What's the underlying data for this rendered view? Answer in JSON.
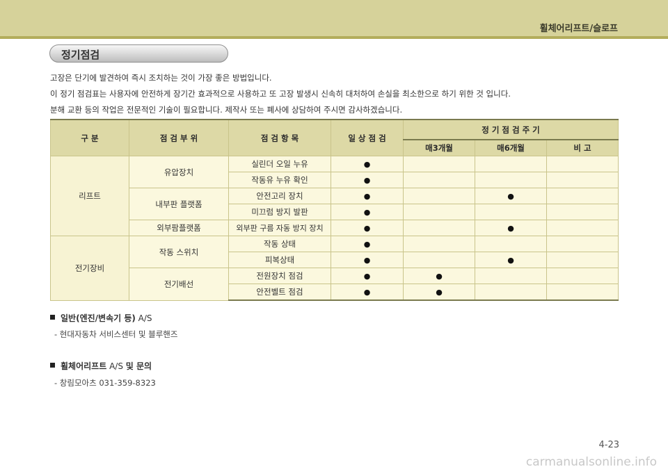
{
  "header": {
    "title": "휠체어리프트/슬로프"
  },
  "section": {
    "title": "정기점검"
  },
  "intro": [
    "고장은 단기에 발견하여 즉시 조치하는 것이 가장 좋은 방법입니다.",
    "이 정기 점검표는 사용자에 안전하게 장기간 효과적으로 사용하고 또 고장 발생시 신속히 대처하여 손실을 최소한으로 하기 위한 것 입니다.",
    "분해 교환 등의 작업은 전문적인 기술이 필요합니다. 제작사 또는 폐사에 상담하여 주시면 감사하겠습니다."
  ],
  "table": {
    "headers": {
      "category": "구 분",
      "part": "점 검 부 위",
      "item": "점 검 항 목",
      "daily": "일 상 점 검",
      "cycle": "정 기 점 검 주 기",
      "m3": "매3개월",
      "m6": "매6개월",
      "remark": "비 고"
    },
    "dot": "●",
    "categories": [
      "리프트",
      "전기장비"
    ],
    "parts": [
      "유압장치",
      "내부판 플랫폼",
      "외부팜플랫폼",
      "작동 스위치",
      "전기배선"
    ],
    "items": [
      "실린더 오일 누유",
      "작동유 누유 확인",
      "안전고리 장치",
      "미끄럼 방지 발판",
      "외부판 구름 자동 방지 장치",
      "작동 상태",
      "피복상태",
      "전원장치 점검",
      "안전벨트 점검"
    ],
    "marks": [
      {
        "daily": true,
        "m3": false,
        "m6": false
      },
      {
        "daily": true,
        "m3": false,
        "m6": false
      },
      {
        "daily": true,
        "m3": false,
        "m6": true
      },
      {
        "daily": true,
        "m3": false,
        "m6": false
      },
      {
        "daily": true,
        "m3": false,
        "m6": true
      },
      {
        "daily": true,
        "m3": false,
        "m6": false
      },
      {
        "daily": true,
        "m3": false,
        "m6": true
      },
      {
        "daily": true,
        "m3": true,
        "m6": false
      },
      {
        "daily": true,
        "m3": true,
        "m6": false
      }
    ]
  },
  "notes": [
    {
      "bold": "일반(엔진/변속기 등)",
      "rest": " A/S",
      "sub": "- 현대자동차 서비스센터 및 블루핸즈"
    },
    {
      "bold": "휠체어리프트",
      "rest": " A/S ",
      "bold2": "및 문의",
      "sub": "- 창림모아츠   031-359-8323"
    }
  ],
  "page_number": "4-23",
  "watermark": "carmanualsonline.info"
}
